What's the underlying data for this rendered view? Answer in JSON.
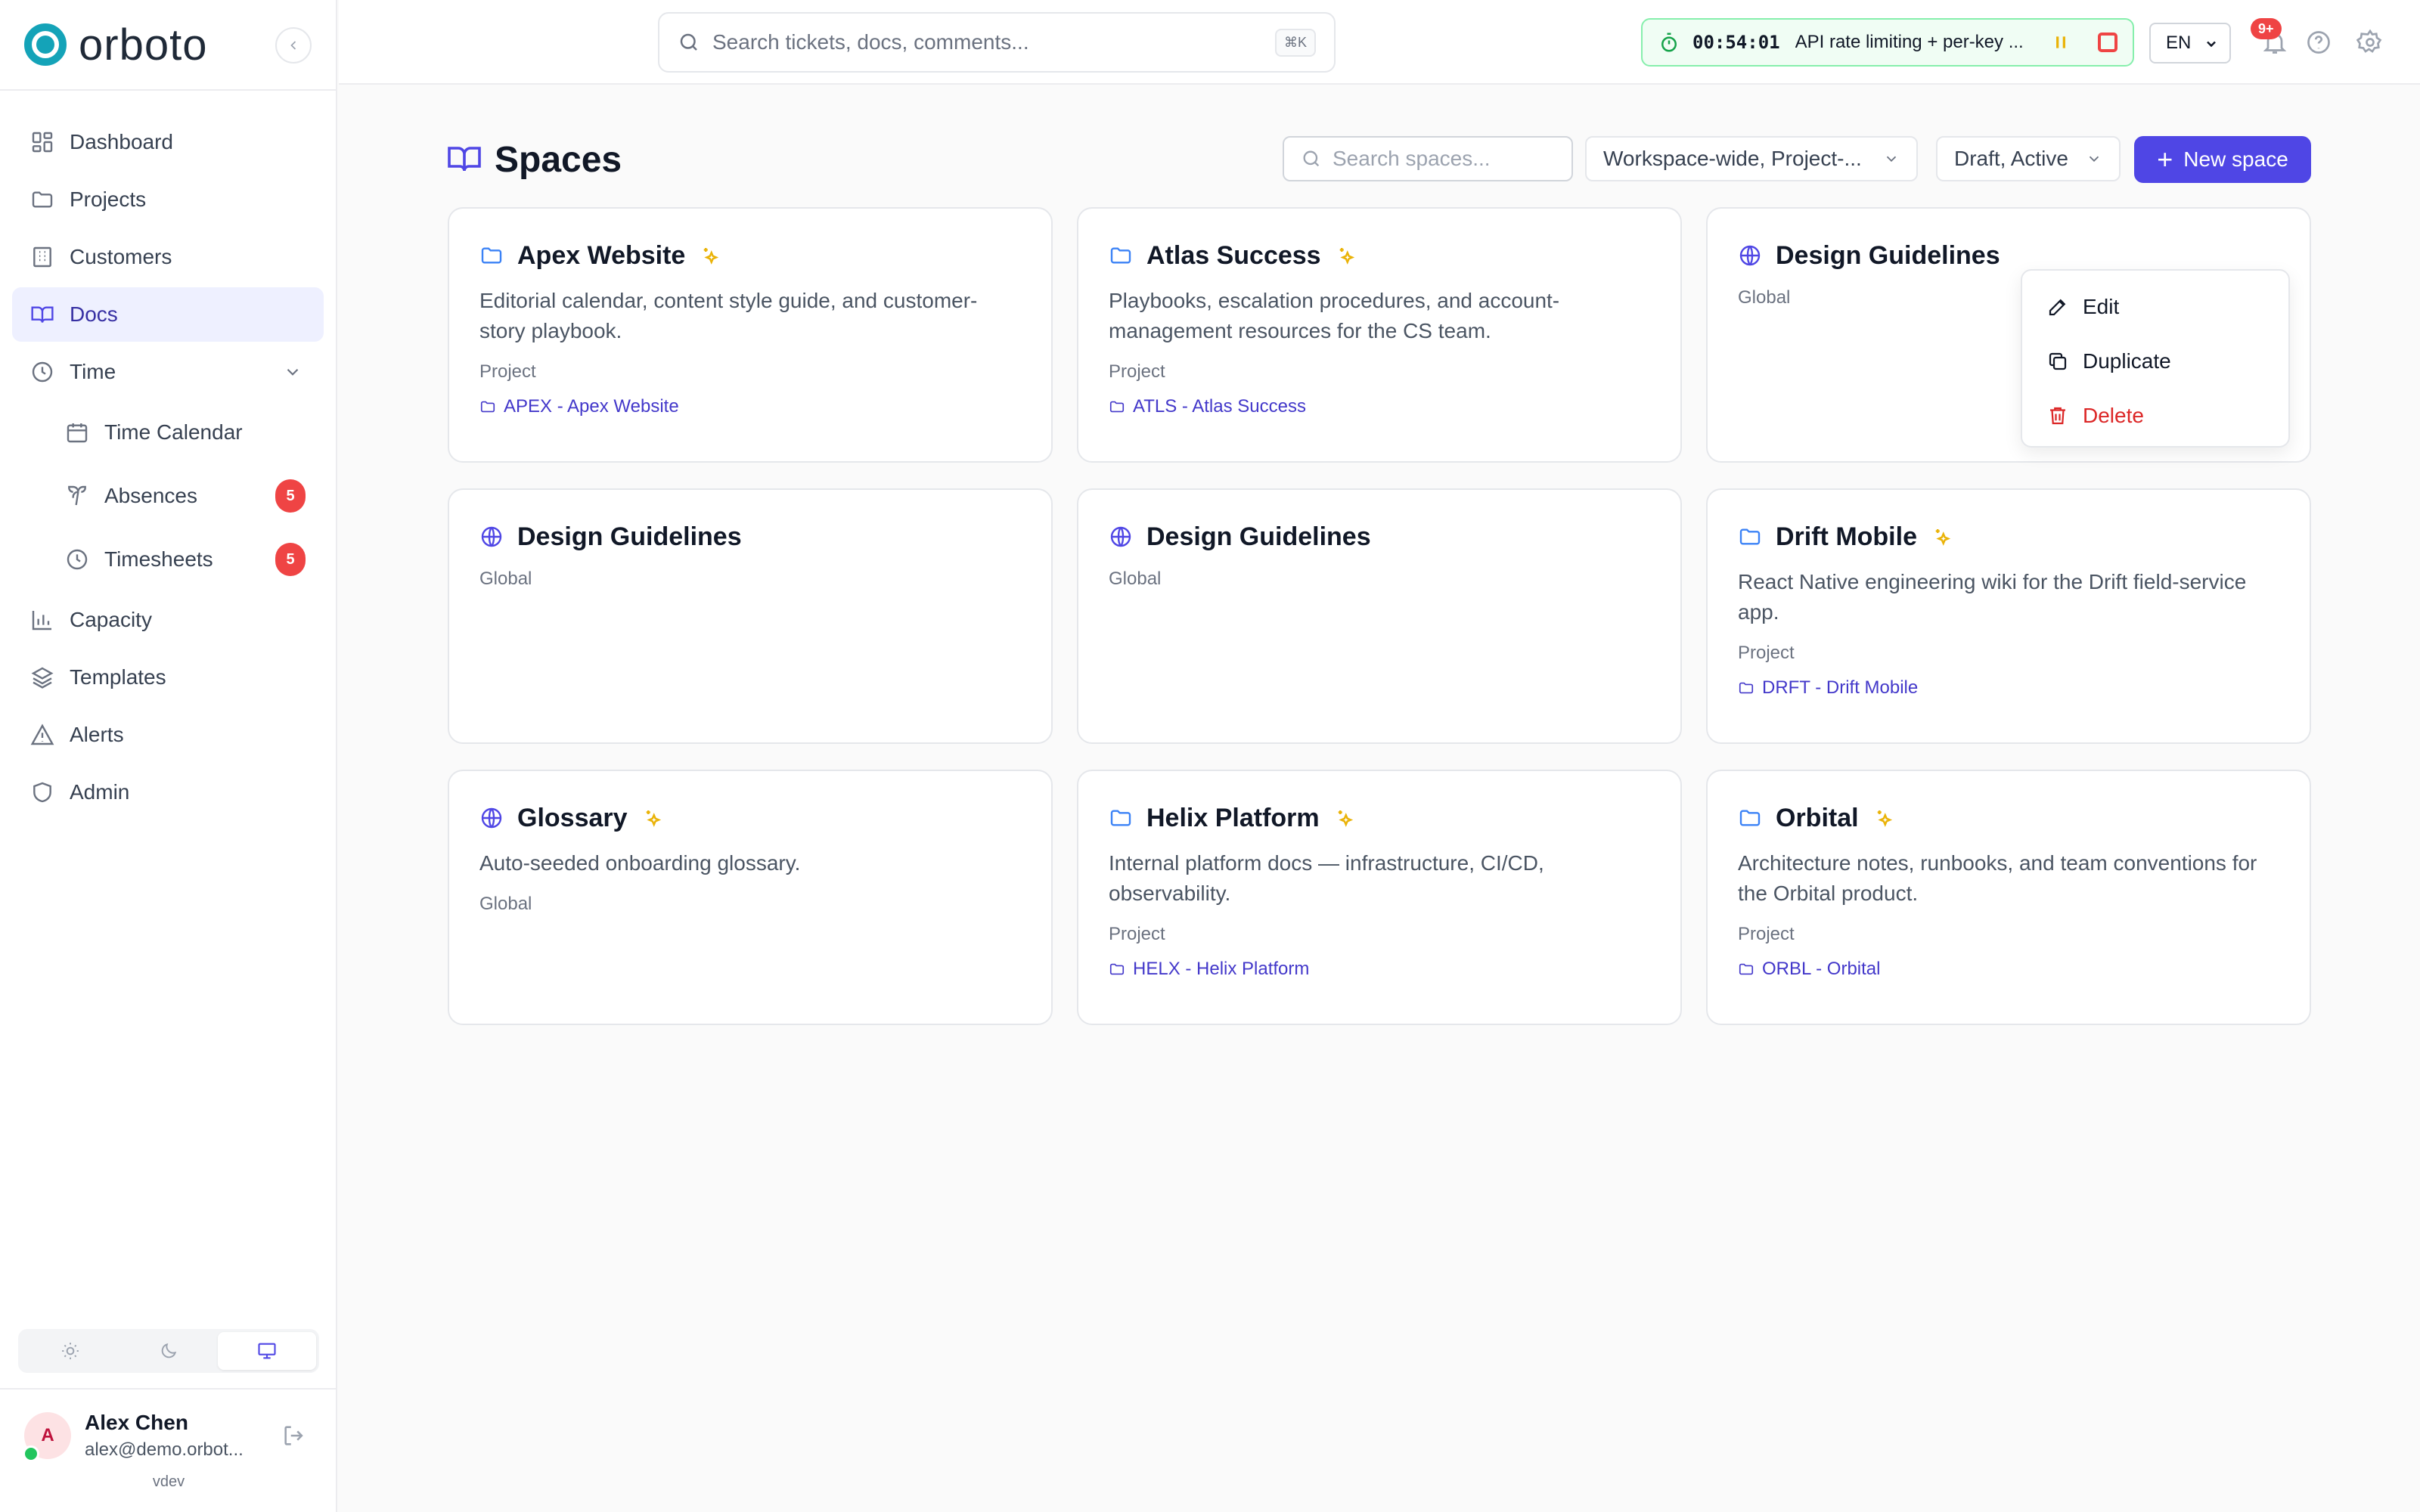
{
  "brand": {
    "name": "orboto",
    "accent": "#14a3b8"
  },
  "sidebar": {
    "items": [
      {
        "label": "Dashboard",
        "icon": "dashboard-icon"
      },
      {
        "label": "Projects",
        "icon": "folder-icon"
      },
      {
        "label": "Customers",
        "icon": "building-icon"
      },
      {
        "label": "Docs",
        "icon": "book-icon",
        "active": true
      },
      {
        "label": "Time",
        "icon": "clock-icon",
        "expanded": true
      },
      {
        "label": "Time Calendar",
        "icon": "calendar-icon"
      },
      {
        "label": "Absences",
        "icon": "palm-tree-icon",
        "badge": "5"
      },
      {
        "label": "Timesheets",
        "icon": "clock-icon",
        "badge": "5"
      },
      {
        "label": "Capacity",
        "icon": "bar-chart-icon"
      },
      {
        "label": "Templates",
        "icon": "layers-icon"
      },
      {
        "label": "Alerts",
        "icon": "alert-triangle-icon"
      },
      {
        "label": "Admin",
        "icon": "shield-icon"
      }
    ],
    "theme": {
      "options": [
        "light",
        "dark",
        "system"
      ],
      "selected": "system"
    },
    "user": {
      "initial": "A",
      "name": "Alex Chen",
      "email": "alex@demo.orbot..."
    },
    "version": "vdev"
  },
  "topbar": {
    "search_placeholder": "Search tickets, docs, comments...",
    "search_shortcut": "⌘K",
    "timer": {
      "time": "00:54:01",
      "label": "API rate limiting + per-key ..."
    },
    "language": "EN",
    "notifications_badge": "9+"
  },
  "main": {
    "title": "Spaces",
    "search_placeholder": "Search spaces...",
    "scope_filter": "Workspace-wide, Project-...",
    "status_filter": "Draft, Active",
    "new_button": "New space",
    "cards": [
      {
        "title": "Apex Website",
        "scope": "project",
        "starred": true,
        "description": "Editorial calendar, content style guide, and customer-story playbook.",
        "type": "Project",
        "link": "APEX - Apex Website"
      },
      {
        "title": "Atlas Success",
        "scope": "project",
        "starred": true,
        "description": "Playbooks, escalation procedures, and account-management resources for the CS team.",
        "type": "Project",
        "link": "ATLS - Atlas Success"
      },
      {
        "title": "Design Guidelines",
        "scope": "global",
        "starred": false,
        "description": "",
        "type": "Global",
        "link": ""
      },
      {
        "title": "Design Guidelines",
        "scope": "global",
        "starred": false,
        "description": "",
        "type": "Global",
        "link": ""
      },
      {
        "title": "Design Guidelines",
        "scope": "global",
        "starred": false,
        "description": "",
        "type": "Global",
        "link": ""
      },
      {
        "title": "Drift Mobile",
        "scope": "project",
        "starred": true,
        "description": "React Native engineering wiki for the Drift field-service app.",
        "type": "Project",
        "link": "DRFT - Drift Mobile"
      },
      {
        "title": "Glossary",
        "scope": "global",
        "starred": true,
        "description": "Auto-seeded onboarding glossary.",
        "type": "Global",
        "link": ""
      },
      {
        "title": "Helix Platform",
        "scope": "project",
        "starred": true,
        "description": "Internal platform docs — infrastructure, CI/CD, observability.",
        "type": "Project",
        "link": "HELX - Helix Platform"
      },
      {
        "title": "Orbital",
        "scope": "project",
        "starred": true,
        "description": "Architecture notes, runbooks, and team conventions for the Orbital product.",
        "type": "Project",
        "link": "ORBL - Orbital"
      }
    ],
    "context_menu": {
      "items": [
        {
          "label": "Edit"
        },
        {
          "label": "Duplicate"
        },
        {
          "label": "Delete"
        }
      ]
    }
  },
  "colors": {
    "primary": "#4f46e5",
    "danger": "#ef4444",
    "star": "#eab308",
    "folder": "#3b82f6"
  }
}
